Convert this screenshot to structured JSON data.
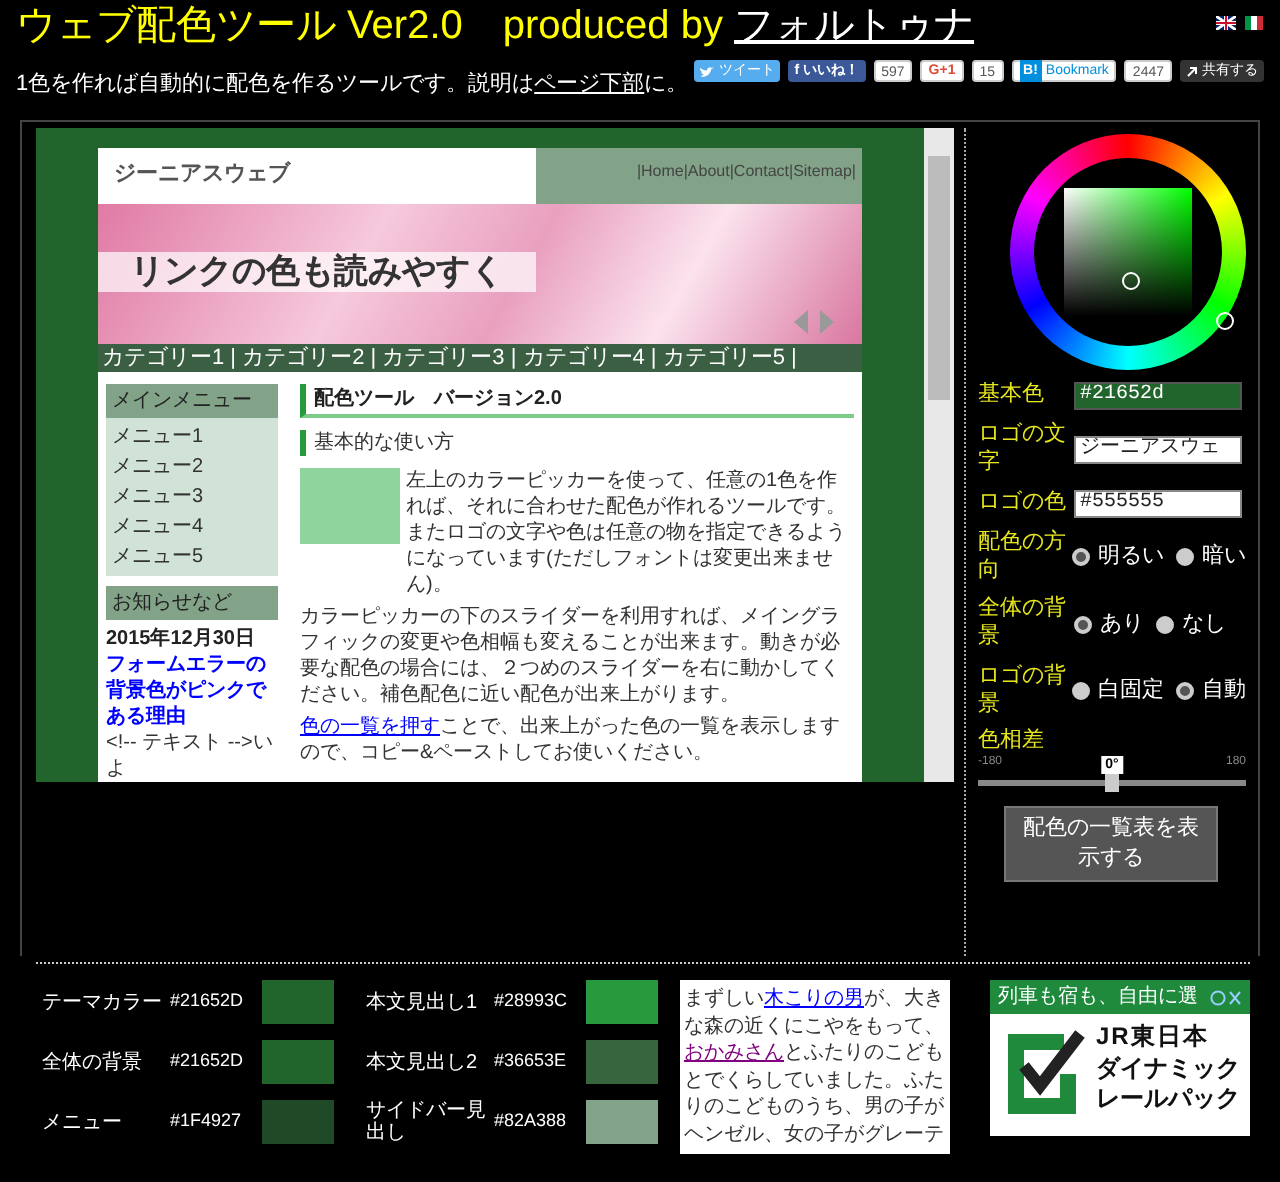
{
  "header": {
    "title": "ウェブ配色ツール Ver2.0　produced by",
    "author_link": "フォルトゥナ",
    "subtitle": "1色を作れば自動的に配色を作るツールです。説明は",
    "subtitle_link": "ページ下部",
    "subtitle_end": "に。"
  },
  "social": [
    {
      "kind": "tweet",
      "label": "ツイート"
    },
    {
      "kind": "facebook",
      "icon_text": "f",
      "label": "いいね！",
      "count": "597"
    },
    {
      "kind": "gplus",
      "label": "G+1",
      "count": "15"
    },
    {
      "kind": "hatena",
      "icon_text": "B!",
      "label": "Bookmark",
      "count": "2447"
    },
    {
      "kind": "share",
      "label": "共有する"
    }
  ],
  "preview": {
    "logo": "ジーニアスウェブ",
    "nav": "|Home|About|Contact|Sitemap|",
    "banner_caption": "リンクの色も読みやすく",
    "category_bar": "カテゴリー1 | カテゴリー2 | カテゴリー3 | カテゴリー4 | カテゴリー5 |",
    "menu_title": "メインメニュー",
    "menu_items": [
      "メニュー1",
      "メニュー2",
      "メニュー3",
      "メニュー4",
      "メニュー5"
    ],
    "news_title": "お知らせなど",
    "news_date": "2015年12月30日",
    "news_link": "フォームエラーの背景色がピンクである理由",
    "news_text": "<!-- テキスト -->いよ",
    "heading_1": "配色ツール　バージョン2.0",
    "heading_2": "基本的な使い方",
    "paragraph_1": "左上のカラーピッカーを使って、任意の1色を作れば、それに合わせた配色が作れるツールです。またロゴの文字や色は任意の物を指定できるようになっています(ただしフォントは変更出来ません)。",
    "paragraph_2": "カラーピッカーの下のスライダーを利用すれば、メイングラフィックの変更や色相幅も変えることが出来ます。動きが必要な配色の場合には、２つめのスライダーを右に動かしてください。補色配色に近い配色が出来上がります。",
    "paragraph_3_link": "色の一覧を押す",
    "paragraph_3": "ことで、出来上がった色の一覧を表示しますので、コピー&ペーストしてお使いください。"
  },
  "controls": {
    "fields": [
      {
        "kind": "color",
        "label": "基本色",
        "value": "#21652d"
      },
      {
        "kind": "text",
        "label": "ロゴの文字",
        "value": "ジーニアスウェ"
      },
      {
        "kind": "text",
        "label": "ロゴの色",
        "value": "#555555"
      }
    ],
    "radio_groups": [
      {
        "label": "配色の方向",
        "options": [
          {
            "label": "明るい",
            "selected": true
          },
          {
            "label": "暗い",
            "selected": false
          }
        ]
      },
      {
        "label": "全体の背景",
        "options": [
          {
            "label": "あり",
            "selected": true
          },
          {
            "label": "なし",
            "selected": false
          }
        ]
      },
      {
        "label": "ロゴの背景",
        "options": [
          {
            "label": "白固定",
            "selected": false
          },
          {
            "label": "自動",
            "selected": true
          }
        ]
      }
    ],
    "slider": {
      "label": "色相差",
      "min": "-180",
      "max": "180",
      "value": "0°",
      "level": 0.5
    },
    "button": "配色の一覧表を表示する"
  },
  "palette": [
    {
      "label": "テーマカラー",
      "code": "#21652D",
      "color": "#21652d"
    },
    {
      "label": "全体の背景",
      "code": "#21652D",
      "color": "#21652d"
    },
    {
      "label": "メニュー",
      "code": "#1F4927",
      "color": "#1f4927"
    },
    {
      "label": "本文見出し1",
      "code": "#28993C",
      "color": "#28993c"
    },
    {
      "label": "本文見出し2",
      "code": "#36653E",
      "color": "#36653e"
    },
    {
      "label": "サイドバー見出し",
      "code": "#82A388",
      "color": "#82a388"
    }
  ],
  "sample_text": [
    {
      "kind": "text",
      "text": "まずしい"
    },
    {
      "kind": "link",
      "text": "木こりの男"
    },
    {
      "kind": "text",
      "text": "が、大きな森の近くにこやをもって、"
    },
    {
      "kind": "visited",
      "text": "おかみさん"
    },
    {
      "kind": "text",
      "text": "とふたりのこどもとでくらしていました。ふたりのこどものうち、男の子がヘンゼル、女の子がグレーテ"
    }
  ],
  "ad": {
    "headline": "列車も宿も、自由に選",
    "brand": "JR東日本",
    "lines": [
      "ダイナミック",
      "レールパック"
    ]
  }
}
